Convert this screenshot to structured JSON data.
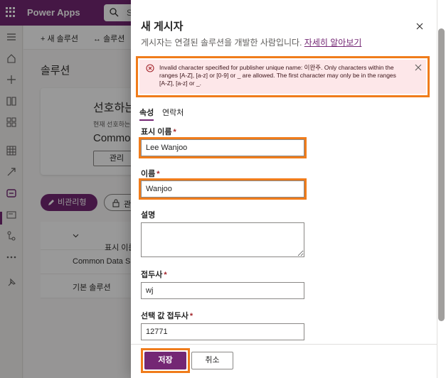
{
  "app": {
    "title": "Power Apps",
    "search_placeholder": "S"
  },
  "command_bar": {
    "new_solution": "새 솔루션",
    "solution": "솔루션"
  },
  "page": {
    "title": "솔루션",
    "preferred_card": {
      "heading": "선호하는",
      "current_label": "현재 선호하는",
      "value": "Common",
      "manage_label": "관리"
    },
    "pills": {
      "unmanaged": "비관리형",
      "managed": "관"
    },
    "table": {
      "header": "표시 이름",
      "rows": [
        "Common Data S",
        "기본 솔루션"
      ]
    }
  },
  "panel": {
    "title": "새 게시자",
    "subtitle": "게시자는 연결된 솔루션을 개발한 사람입니다.",
    "learn_more": "자세히 알아보기",
    "error": "Invalid character specified for publisher unique name: 이완주. Only characters within the ranges [A-Z], [a-z] or [0-9] or _ are allowed. The first character may only be in the ranges [A-Z], [a-z] or _.",
    "tabs": [
      "속성",
      "연락처"
    ],
    "fields": {
      "display_name": {
        "label": "표시 이름",
        "value": "Lee Wanjoo"
      },
      "name": {
        "label": "이름",
        "value": "Wanjoo"
      },
      "description": {
        "label": "설명",
        "value": ""
      },
      "prefix": {
        "label": "접두사",
        "value": "wj"
      },
      "option_prefix": {
        "label": "선택 값 접두사",
        "value": "12771"
      }
    },
    "required_mark": "*",
    "save_label": "저장",
    "cancel_label": "취소"
  },
  "colors": {
    "brand": "#742774",
    "highlight": "#f07c1b",
    "error_bg": "#fde7e9",
    "error_icon": "#a4262c"
  },
  "icons": [
    "waffle-icon",
    "search-icon",
    "menu-icon",
    "home-icon",
    "plus-icon",
    "book-icon",
    "apps-icon",
    "table-icon",
    "flow-icon",
    "solutions-icon",
    "card-icon",
    "connector-icon",
    "more-icon",
    "pin-icon",
    "close-icon",
    "error-icon",
    "pencil-icon",
    "lock-icon",
    "chevron-down-icon"
  ]
}
